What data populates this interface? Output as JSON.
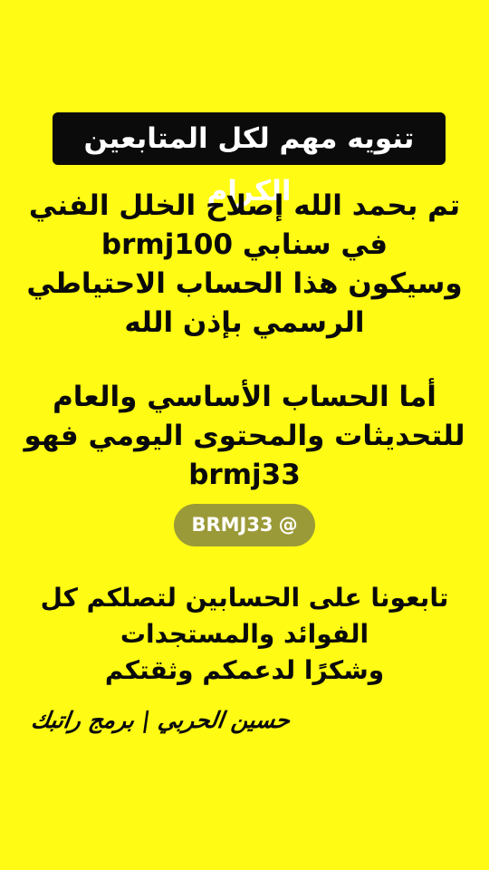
{
  "banner": {
    "title": "تنويه مهم لكل المتابعين الكرام"
  },
  "announcement": {
    "lines": [
      "تم بحمد الله إصلاح الخلل الفني",
      "في سنابي brmj100",
      "وسيكون هذا الحساب الاحتياطي",
      "الرسمي بإذن الله"
    ]
  },
  "main_account": {
    "lines": [
      "أما الحساب الأساسي والعام",
      "للتحديثات والمحتوى اليومي فهو",
      "brmj33"
    ]
  },
  "mention": {
    "at_symbol": "@",
    "username": "BRMJ33"
  },
  "closing": {
    "lines": [
      "تابعونا على الحسابين لتصلكم كل",
      "الفوائد والمستجدات",
      "وشكرًا لدعمكم وثقتكم"
    ]
  },
  "signature": {
    "text": "حسين الحربي | برمج راتبك"
  }
}
